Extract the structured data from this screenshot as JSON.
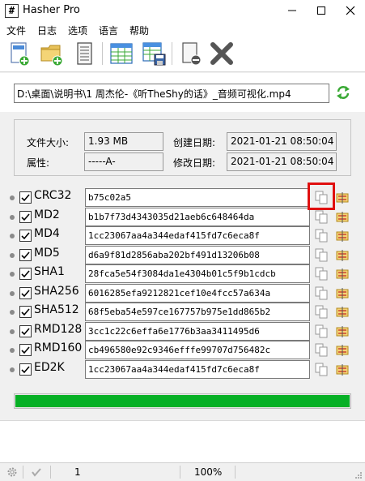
{
  "window": {
    "title": "Hasher Pro",
    "app_icon_glyph": "#"
  },
  "menu": [
    "文件",
    "日志",
    "选项",
    "语言",
    "帮助"
  ],
  "toolbar": {
    "icons": [
      "add-file-icon",
      "add-folder-icon",
      "document-icon",
      "table-icon",
      "table-save-icon",
      "remove-file-icon",
      "delete-x-icon"
    ]
  },
  "file": {
    "path": "D:\\桌面\\说明书\\1 周杰伦-《听TheShy的话》_音频可视化.mp4"
  },
  "info": {
    "size_label": "文件大小:",
    "size_value": "1.93 MB",
    "attr_label": "属性:",
    "attr_value": "-----A-",
    "created_label": "创建日期:",
    "created_value": "2021-01-21 08:50:04",
    "modified_label": "修改日期:",
    "modified_value": "2021-01-21 08:50:04"
  },
  "hashes": [
    {
      "name": "CRC32",
      "value": "b75c02a5"
    },
    {
      "name": "MD2",
      "value": "b1b7f73d4343035d21aeb6c648464da"
    },
    {
      "name": "MD4",
      "value": "1cc23067aa4a344edaf415fd7c6eca8f"
    },
    {
      "name": "MD5",
      "value": "d6a9f81d2856aba202bf491d13206b08"
    },
    {
      "name": "SHA1",
      "value": "28fca5e54f3084da1e4304b01c5f9b1cdcb"
    },
    {
      "name": "SHA256",
      "value": "6016285efa9212821cef10e4fcc57a634a"
    },
    {
      "name": "SHA512",
      "value": "68f5eba54e597ce167757b975e1dd865b2"
    },
    {
      "name": "RMD128",
      "value": "3cc1c22c6effa6e1776b3aa3411495d6"
    },
    {
      "name": "RMD160",
      "value": "cb496580e92c9346efffe99707d756482c"
    },
    {
      "name": "ED2K",
      "value": "1cc23067aa4a344edaf415fd7c6eca8f"
    }
  ],
  "progress": {
    "fraction": 1.0,
    "color": "#06b025"
  },
  "status": {
    "count": "1",
    "zoom": "100%"
  },
  "colors": {
    "highlight": "#e01010",
    "accent_green": "#3aa935"
  }
}
